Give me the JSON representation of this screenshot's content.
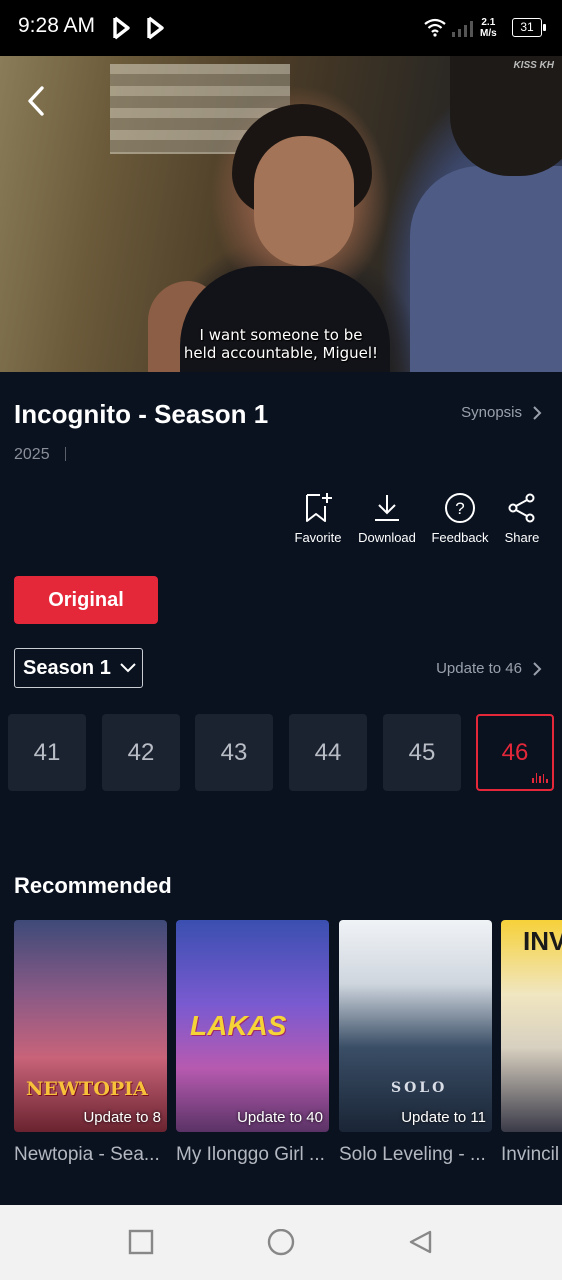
{
  "status_bar": {
    "time": "9:28 AM",
    "speed_top": "2.1",
    "speed_bottom": "M/s",
    "battery": "31"
  },
  "hero": {
    "subtitle_line1": "I want someone to be",
    "subtitle_line2": "held accountable, Miguel!",
    "watermark": "KISS KH"
  },
  "show": {
    "title": "Incognito - Season 1",
    "synopsis_label": "Synopsis",
    "year": "2025"
  },
  "actions": [
    {
      "label": "Favorite",
      "icon": "bookmark-plus-icon"
    },
    {
      "label": "Download",
      "icon": "download-icon"
    },
    {
      "label": "Feedback",
      "icon": "question-icon"
    },
    {
      "label": "Share",
      "icon": "share-icon"
    }
  ],
  "version_button": "Original",
  "season": {
    "selected": "Season 1",
    "update_label": "Update to 46"
  },
  "episodes": [
    "41",
    "42",
    "43",
    "44",
    "45",
    "46"
  ],
  "active_episode": "46",
  "recommended": {
    "title": "Recommended",
    "items": [
      {
        "name": "Newtopia - Sea...",
        "badge": "Update to 8",
        "poster_text": "NEWTOPIA"
      },
      {
        "name": "My Ilonggo Girl ...",
        "badge": "Update to 40",
        "poster_text": "LAKAS"
      },
      {
        "name": "Solo Leveling - ...",
        "badge": "Update to 11",
        "poster_text": "SOLO"
      },
      {
        "name": "Invincil",
        "badge": "",
        "poster_text": "INVI"
      }
    ]
  },
  "colors": {
    "accent": "#e5273a",
    "background": "#0a1220",
    "tile": "#1b2230"
  }
}
